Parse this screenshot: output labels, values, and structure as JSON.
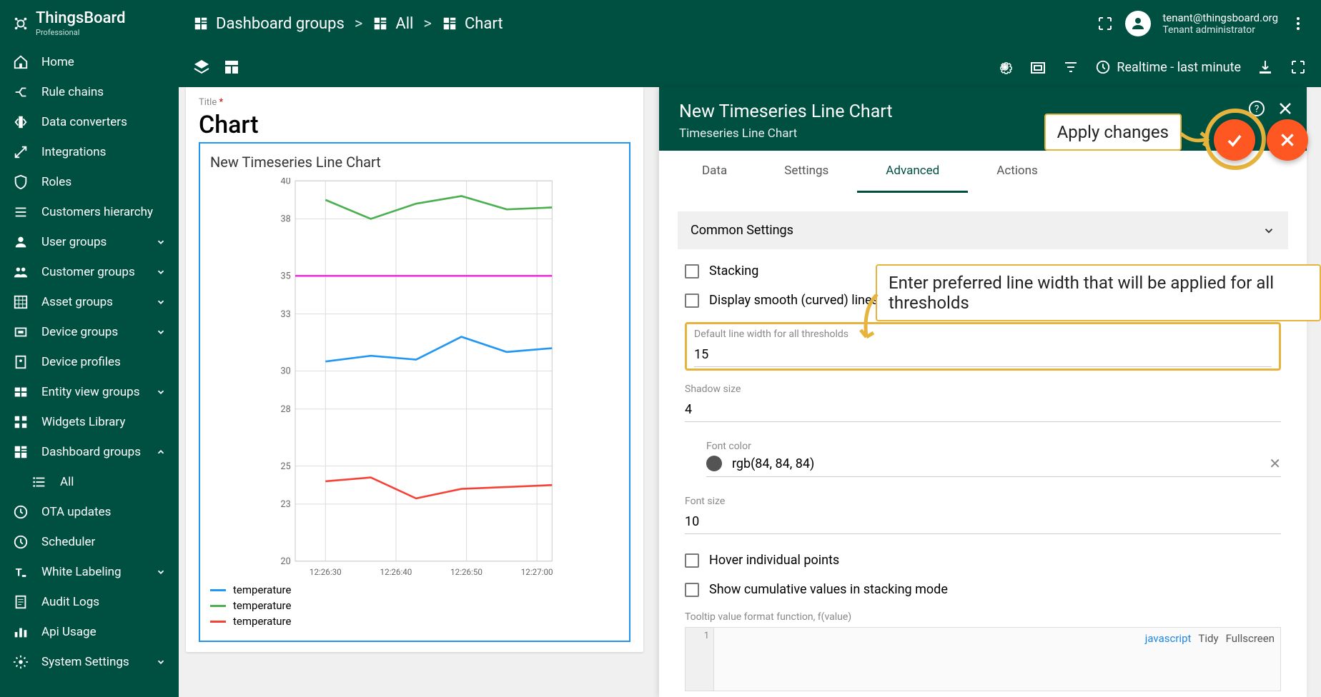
{
  "logo": {
    "name": "ThingsBoard",
    "sub": "Professional"
  },
  "nav": [
    {
      "label": "Home",
      "icon": "home"
    },
    {
      "label": "Rule chains",
      "icon": "rule"
    },
    {
      "label": "Data converters",
      "icon": "convert"
    },
    {
      "label": "Integrations",
      "icon": "integration"
    },
    {
      "label": "Roles",
      "icon": "shield"
    },
    {
      "label": "Customers hierarchy",
      "icon": "hierarchy"
    },
    {
      "label": "User groups",
      "icon": "user",
      "chev": "down"
    },
    {
      "label": "Customer groups",
      "icon": "customers",
      "chev": "down"
    },
    {
      "label": "Asset groups",
      "icon": "asset",
      "chev": "down"
    },
    {
      "label": "Device groups",
      "icon": "device",
      "chev": "down"
    },
    {
      "label": "Device profiles",
      "icon": "profile"
    },
    {
      "label": "Entity view groups",
      "icon": "entity",
      "chev": "down"
    },
    {
      "label": "Widgets Library",
      "icon": "widgets"
    },
    {
      "label": "Dashboard groups",
      "icon": "dashboard",
      "chev": "up",
      "active": true
    },
    {
      "label": "All",
      "icon": "list",
      "sub": true
    },
    {
      "label": "OTA updates",
      "icon": "ota"
    },
    {
      "label": "Scheduler",
      "icon": "clock"
    },
    {
      "label": "White Labeling",
      "icon": "wl",
      "chev": "down"
    },
    {
      "label": "Audit Logs",
      "icon": "audit"
    },
    {
      "label": "Api Usage",
      "icon": "api"
    },
    {
      "label": "System Settings",
      "icon": "settings",
      "chev": "down"
    }
  ],
  "breadcrumb": [
    {
      "label": "Dashboard groups"
    },
    {
      "label": "All"
    },
    {
      "label": "Chart"
    }
  ],
  "user": {
    "email": "tenant@thingsboard.org",
    "role": "Tenant administrator"
  },
  "toolbar": {
    "time": "Realtime - last minute"
  },
  "card": {
    "title_label": "Title",
    "title": "Chart",
    "widget_title": "New Timeseries Line Chart",
    "legend": [
      {
        "label": "temperature",
        "color": "#2196f3"
      },
      {
        "label": "temperature",
        "color": "#4caf50"
      },
      {
        "label": "temperature",
        "color": "#f44336"
      }
    ]
  },
  "chart_data": {
    "type": "line",
    "x": [
      "12:26:30",
      "12:26:40",
      "12:26:50",
      "12:27:00"
    ],
    "x_ticks": [
      "12:26:30",
      "12:26:40",
      "12:26:50",
      "12:27:00"
    ],
    "ylim": [
      20,
      40
    ],
    "y_ticks": [
      20,
      23,
      25,
      28,
      30,
      33,
      35,
      38,
      40
    ],
    "series": [
      {
        "name": "temperature",
        "color": "#2196f3",
        "values": [
          30.5,
          30.8,
          30.6,
          31.8,
          31.0,
          31.2
        ]
      },
      {
        "name": "temperature",
        "color": "#4caf50",
        "values": [
          39.0,
          38.0,
          38.8,
          39.2,
          38.5,
          38.6
        ]
      },
      {
        "name": "temperature",
        "color": "#f44336",
        "values": [
          24.2,
          24.4,
          23.3,
          23.8,
          23.9,
          24.0
        ]
      }
    ],
    "threshold": {
      "value": 35,
      "color": "#ff00e0"
    }
  },
  "panel": {
    "title": "New Timeseries Line Chart",
    "subtitle": "Timeseries Line Chart",
    "tabs": [
      "Data",
      "Settings",
      "Advanced",
      "Actions"
    ],
    "active_tab": "Advanced",
    "section_title": "Common Settings",
    "stacking_label": "Stacking",
    "smooth_label": "Display smooth (curved) lines",
    "linewidth_label": "Default line width for all thresholds",
    "linewidth_value": "15",
    "shadow_label": "Shadow size",
    "shadow_value": "4",
    "fontcolor_label": "Font color",
    "fontcolor_value": "rgb(84, 84, 84)",
    "fontsize_label": "Font size",
    "fontsize_value": "10",
    "hover_label": "Hover individual points",
    "cumulative_label": "Show cumulative values in stacking mode",
    "tooltip_fn_label": "Tooltip value format function, f(value)",
    "func_tools": {
      "lang": "javascript",
      "tidy": "Tidy",
      "fullscreen": "Fullscreen"
    }
  },
  "callouts": {
    "apply": "Apply changes",
    "linewidth": "Enter preferred line width that will be applied for all thresholds"
  },
  "colors": {
    "teal": "#005042",
    "orange": "#ff5722",
    "highlight": "#e6b33c"
  }
}
